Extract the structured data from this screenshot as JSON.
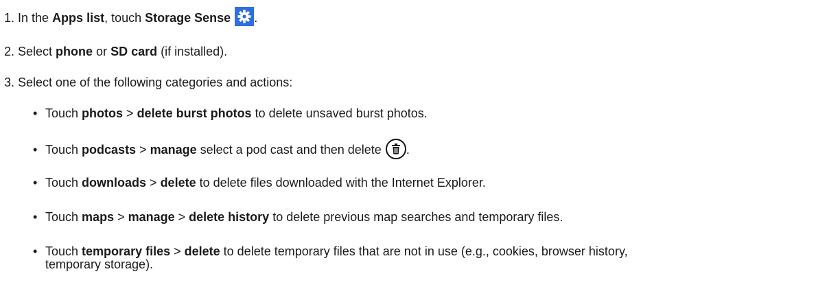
{
  "steps": [
    {
      "num": "1.",
      "text_a": " In the ",
      "bold_a": "Apps list",
      "text_b": ", touch ",
      "bold_b": "Storage Sense",
      "text_end": ".",
      "icon": "settings-gear-icon",
      "icon_color": "#2f6fe0"
    },
    {
      "num": "2.",
      "text_a": " Select ",
      "bold_a": "phone",
      "text_b": " or ",
      "bold_b": "SD card",
      "text_end": " (if installed)."
    },
    {
      "num": "3.",
      "text_a": " Select one of the following categories and actions:"
    }
  ],
  "bullets": [
    {
      "text_a": "Touch ",
      "bold_a": "photos",
      "sep_a": " > ",
      "bold_b": "delete burst photos",
      "text_end": " to delete unsaved burst photos."
    },
    {
      "text_a": "Touch ",
      "bold_a": "podcasts",
      "sep_a": " > ",
      "bold_b": "manage",
      "text_end": " select a pod cast and then delete",
      "icon": "trash-icon",
      "text_after_icon": "."
    },
    {
      "text_a": "Touch ",
      "bold_a": "downloads",
      "sep_a": " > ",
      "bold_b": "delete",
      "text_end": " to delete files downloaded with the Internet Explorer."
    },
    {
      "text_a": "Touch ",
      "bold_a": "maps",
      "sep_a": " > ",
      "bold_b": "manage",
      "sep_b": " > ",
      "bold_c": "delete history",
      "text_end": " to delete previous map searches and temporary files."
    },
    {
      "text_a": "Touch ",
      "bold_a": "temporary files",
      "sep_a": " > ",
      "bold_b": "delete",
      "text_end": " to delete temporary files that are not in use (e.g., cookies, browser history,",
      "text_line2": "temporary storage)."
    }
  ]
}
